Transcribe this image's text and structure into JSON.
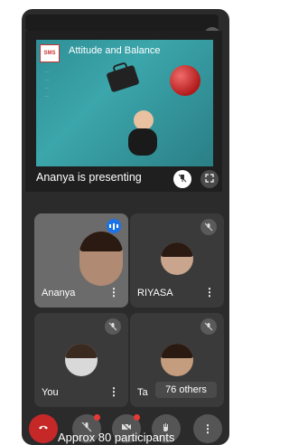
{
  "presentation": {
    "slide": {
      "logo_text": "SMS",
      "title": "Attitude and Balance",
      "bullets": [
        "...",
        "...",
        "...",
        "..."
      ]
    },
    "presenter_label": "Ananya is presenting"
  },
  "tiles": [
    {
      "name": "Ananya"
    },
    {
      "name": "RIYASA"
    },
    {
      "name": "You"
    },
    {
      "name": "Ta"
    }
  ],
  "others_badge": "76 others",
  "participants_text": "Approx 80 participants",
  "colors": {
    "end_call": "#c62828",
    "speaking": "#1a73e8",
    "tile_bg": "#3a3a3a"
  },
  "icons": [
    "mic-off-icon",
    "pin-icon",
    "fullscreen-icon",
    "more-vertical-icon",
    "speaking-icon",
    "end-call-icon",
    "video-off-icon",
    "hand-raise-icon"
  ]
}
